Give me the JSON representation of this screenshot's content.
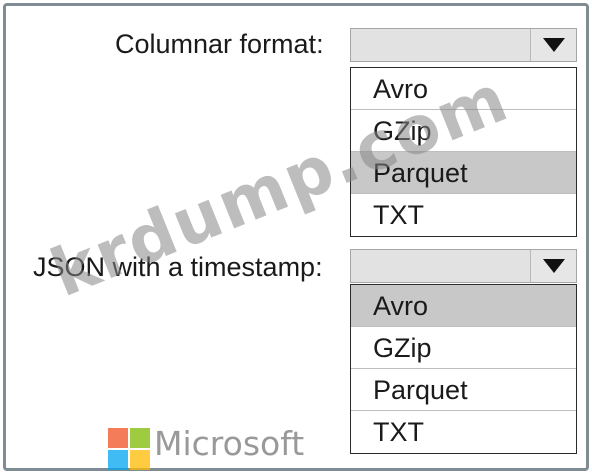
{
  "groups": [
    {
      "label": "Columnar format:",
      "selected_value": "",
      "options": [
        {
          "label": "Avro",
          "highlighted": false
        },
        {
          "label": "GZip",
          "highlighted": false
        },
        {
          "label": "Parquet",
          "highlighted": true
        },
        {
          "label": "TXT",
          "highlighted": false
        }
      ]
    },
    {
      "label": "JSON with a timestamp:",
      "selected_value": "",
      "options": [
        {
          "label": "Avro",
          "highlighted": true
        },
        {
          "label": "GZip",
          "highlighted": false
        },
        {
          "label": "Parquet",
          "highlighted": false
        },
        {
          "label": "TXT",
          "highlighted": false
        }
      ]
    }
  ],
  "watermark": "krdump.com",
  "logo": {
    "text": "Microsoft",
    "colors": [
      "#f25022",
      "#7fba00",
      "#00a4ef",
      "#ffb900"
    ]
  },
  "colors": {
    "highlight": "#c8c8c8",
    "select_bg": "#e2e2e2",
    "frame_border": "#7f8c94"
  },
  "icons": {
    "dropdown_arrow": "triangle-down-icon"
  }
}
